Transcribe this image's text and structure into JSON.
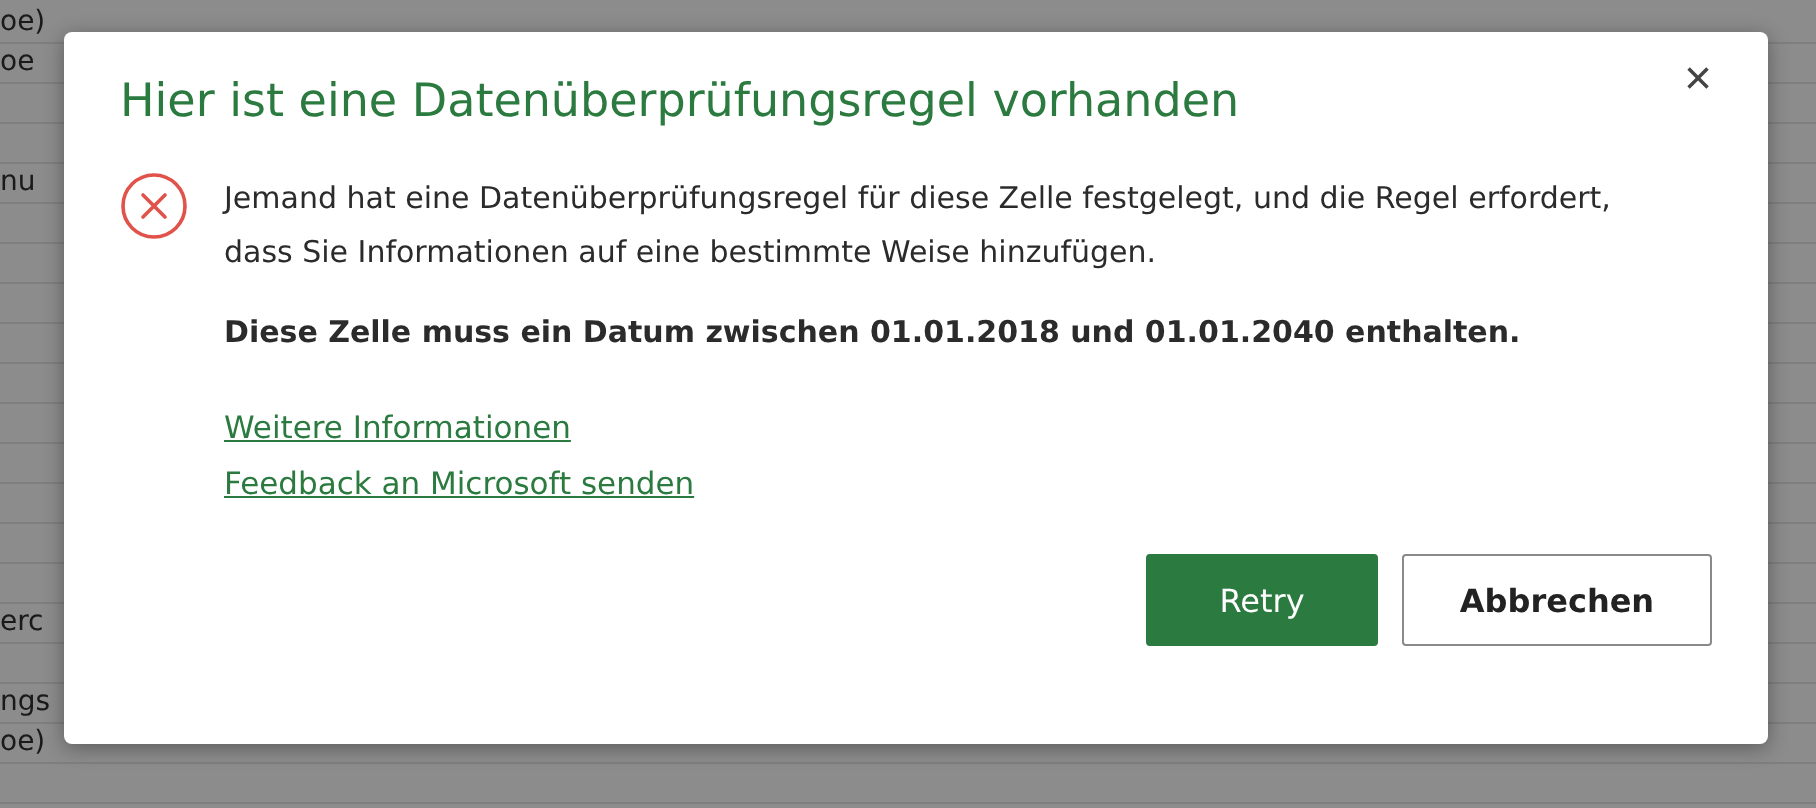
{
  "sheet": {
    "rows": [
      {
        "column_1": "oe)"
      },
      {
        "column_1": "oe"
      },
      {
        "column_1": "nu"
      },
      {
        "column_1": "erc"
      },
      {
        "column_1": "ngs"
      },
      {
        "column_1": "oe)"
      }
    ]
  },
  "dialog": {
    "title": "Hier ist eine Datenüberprüfungsregel vorhanden",
    "close": "×",
    "message": "Jemand hat eine Datenüberprüfungsregel für diese Zelle festgelegt, und die Regel erfordert, dass Sie Informationen auf eine bestimmte Weise hinzufügen.",
    "rule": "Diese Zelle muss ein Datum zwischen 01.01.2018 und 01.01.2040 enthalten.",
    "links": [
      "Weitere Informationen",
      "Feedback an Microsoft senden"
    ],
    "buttons": [
      {
        "label": "Retry",
        "kind": "primary"
      },
      {
        "label": "Abbrechen",
        "kind": "secondary"
      }
    ]
  }
}
